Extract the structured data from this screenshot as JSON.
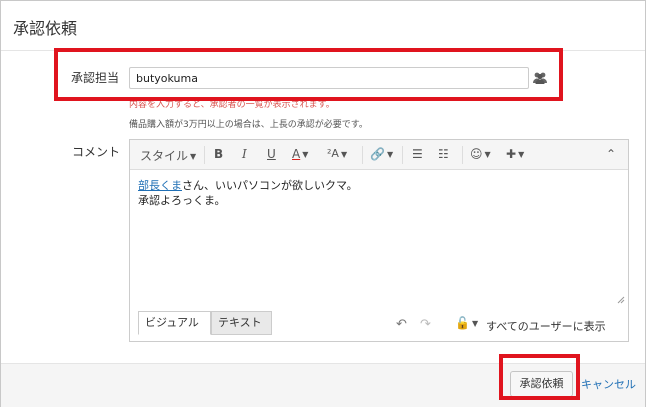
{
  "dialog": {
    "title": "承認依頼"
  },
  "form": {
    "approver_label": "承認担当",
    "approver_value": "butyokuma",
    "help_red": "内容を入力すると、承認者の一覧が表示されます。",
    "help_note": "備品購入額が3万円以上の場合は、上長の承認が必要です。",
    "comment_label": "コメント"
  },
  "editor": {
    "toolbar": {
      "style_label": "スタイル",
      "bold": "B",
      "italic": "I",
      "underline": "U",
      "text_color": "A",
      "font_size": "²A"
    },
    "content": {
      "mention": "部長くま",
      "line1_rest": "さん、いいパソコンが欲しいクマ。",
      "line2": "承認よろっくま。"
    },
    "tabs": {
      "visual": "ビジュアル",
      "text": "テキスト"
    },
    "visibility_label": "すべてのユーザーに表示"
  },
  "footer": {
    "submit_label": "承認依頼",
    "cancel_label": "キャンセル"
  },
  "colors": {
    "highlight": "#e0141e",
    "link": "#1f6fb5",
    "error_text": "#d9534f"
  }
}
